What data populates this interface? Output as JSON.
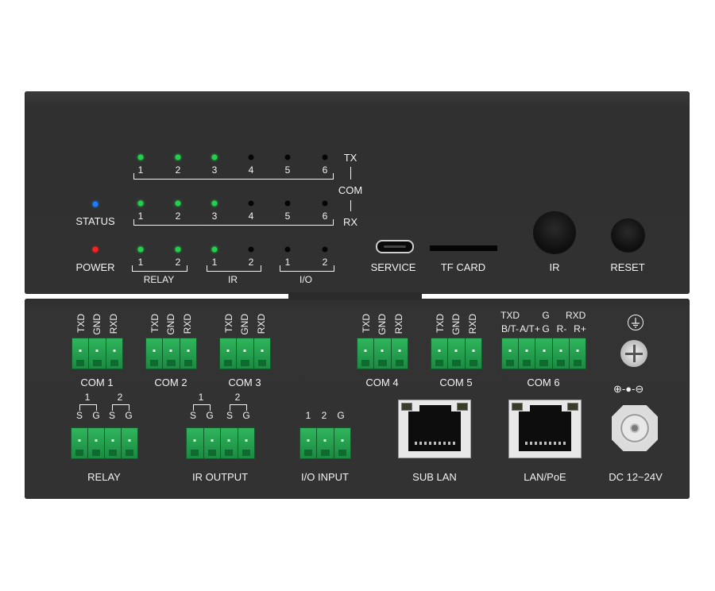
{
  "front": {
    "com_numbers": [
      "1",
      "2",
      "3",
      "4",
      "5",
      "6"
    ],
    "tx_label": "TX",
    "com_label": "COM",
    "rx_label": "RX",
    "tx_led_states": [
      "on",
      "on",
      "on",
      "off",
      "off",
      "off"
    ],
    "rx_led_states": [
      "on",
      "on",
      "on",
      "off",
      "off",
      "off"
    ],
    "status_label": "STATUS",
    "power_label": "POWER",
    "status_color": "#1d7dff",
    "power_color": "#ff2020",
    "led_on_color": "#22d14b",
    "relay": {
      "label": "RELAY",
      "numbers": [
        "1",
        "2"
      ],
      "states": [
        "on",
        "on"
      ]
    },
    "ir": {
      "label": "IR",
      "numbers": [
        "1",
        "2"
      ],
      "states": [
        "on",
        "off"
      ]
    },
    "io": {
      "label": "I/O",
      "numbers": [
        "1",
        "2"
      ],
      "states": [
        "off",
        "off"
      ]
    },
    "service_label": "SERVICE",
    "tf_card_label": "TF CARD",
    "ir_button_label": "IR",
    "reset_label": "RESET"
  },
  "rear": {
    "com_pins": [
      "TXD",
      "GND",
      "RXD"
    ],
    "com1_label": "COM 1",
    "com2_label": "COM 2",
    "com3_label": "COM 3",
    "com4_label": "COM 4",
    "com5_label": "COM 5",
    "com6_label": "COM 6",
    "com6_top": {
      "txd": "TXD",
      "g": "G",
      "rxd": "RXD"
    },
    "com6_pins": [
      "B/T-",
      "A/T+",
      "G",
      "R-",
      "R+"
    ],
    "relay_numbers": [
      "1",
      "2"
    ],
    "s_label": "S",
    "g_label": "G",
    "relay_label": "RELAY",
    "ir_output_label": "IR OUTPUT",
    "io_pins": [
      "1",
      "2",
      "G"
    ],
    "io_input_label": "I/O INPUT",
    "sub_lan_label": "SUB LAN",
    "lan_poe_label": "LAN/PoE",
    "dc_label": "DC 12~24V",
    "polarity": "⊕-●-⊖",
    "ground_icon": "ground-icon",
    "terminal_color": "#1f9a4a"
  }
}
